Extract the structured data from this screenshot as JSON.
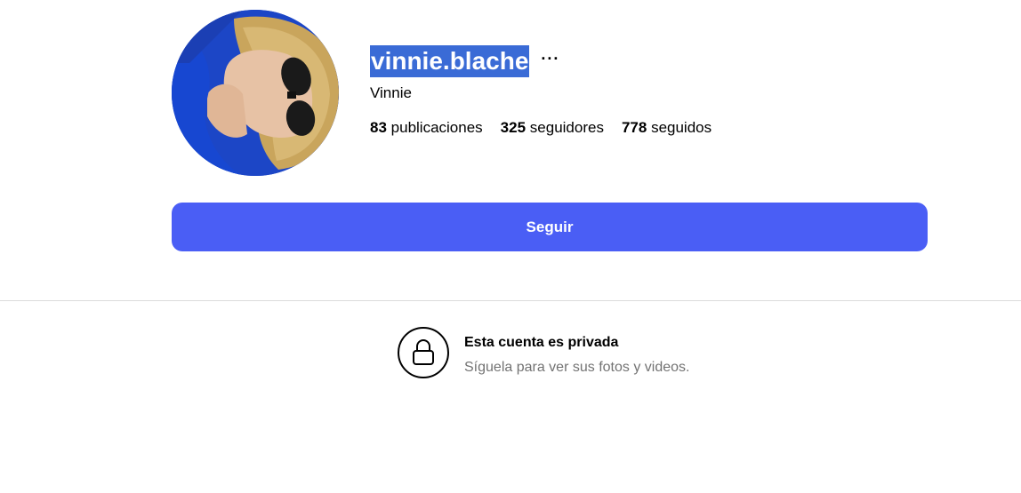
{
  "profile": {
    "username": "vinnie.blache",
    "more_label": "···",
    "full_name": "Vinnie",
    "avatar_icon": "profile-photo-avatar",
    "stats": [
      {
        "count": "83",
        "label": "publicaciones"
      },
      {
        "count": "325",
        "label": "seguidores"
      },
      {
        "count": "778",
        "label": "seguidos"
      }
    ]
  },
  "actions": {
    "follow_label": "Seguir",
    "follow_color": "#4a5ef5"
  },
  "private_notice": {
    "icon": "lock-icon",
    "title": "Esta cuenta es privada",
    "subtitle": "Síguela para ver sus fotos y videos."
  },
  "colors": {
    "username_highlight": "#3a6bd6",
    "divider": "#dbdbdb",
    "muted_text": "#737373"
  }
}
